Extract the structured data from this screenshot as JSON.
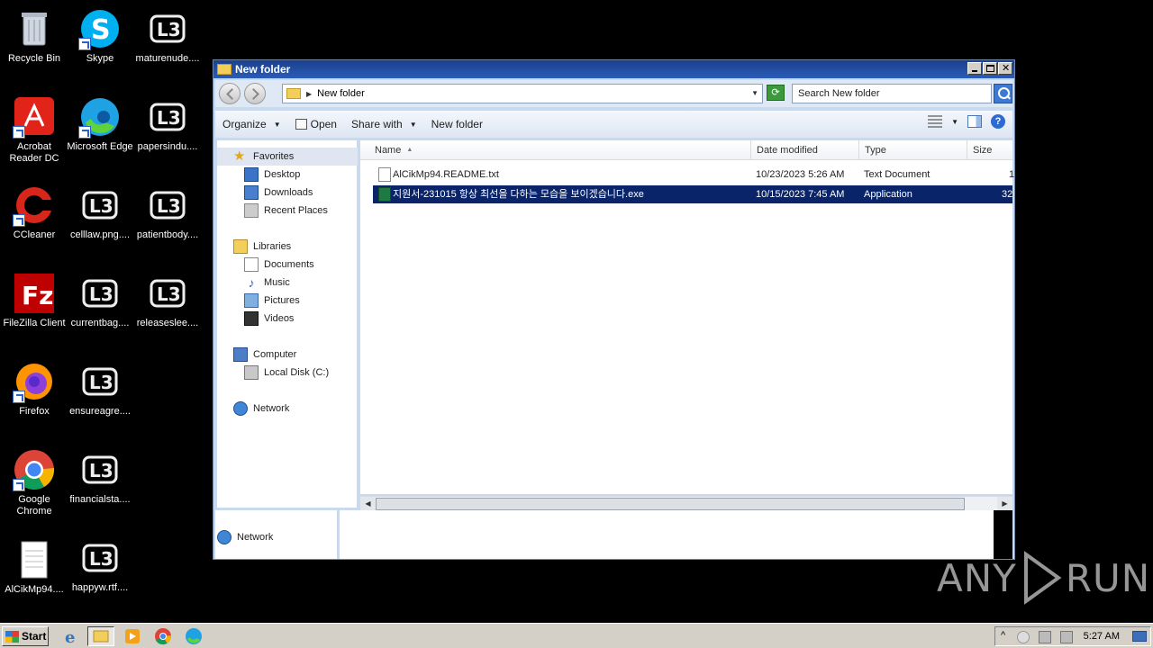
{
  "desktop": {
    "icons": [
      {
        "label": "Recycle Bin",
        "icon": "recycle-bin-icon"
      },
      {
        "label": "Skype",
        "icon": "skype-icon"
      },
      {
        "label": "maturenude....",
        "icon": "generic-doc-icon"
      },
      {
        "label": "Acrobat Reader DC",
        "icon": "acrobat-icon"
      },
      {
        "label": "Microsoft Edge",
        "icon": "edge-icon"
      },
      {
        "label": "papersindu....",
        "icon": "generic-doc-icon"
      },
      {
        "label": "CCleaner",
        "icon": "ccleaner-icon"
      },
      {
        "label": "celllaw.png....",
        "icon": "generic-doc-icon"
      },
      {
        "label": "patientbody....",
        "icon": "generic-doc-icon"
      },
      {
        "label": "FileZilla Client",
        "icon": "filezilla-icon"
      },
      {
        "label": "currentbag....",
        "icon": "generic-doc-icon"
      },
      {
        "label": "releaseslee....",
        "icon": "generic-doc-icon"
      },
      {
        "label": "Firefox",
        "icon": "firefox-icon"
      },
      {
        "label": "ensureagre....",
        "icon": "generic-doc-icon"
      },
      {
        "label": "Google Chrome",
        "icon": "chrome-icon"
      },
      {
        "label": "financialsta....",
        "icon": "generic-doc-icon"
      },
      {
        "label": "AlCikMp94....",
        "icon": "text-file-icon"
      },
      {
        "label": "happyw.rtf....",
        "icon": "generic-doc-icon"
      }
    ]
  },
  "window": {
    "title": "New folder",
    "address": "New folder",
    "search_placeholder": "Search New folder",
    "toolbar": {
      "organize": "Organize",
      "open": "Open",
      "share_with": "Share with",
      "new_folder": "New folder"
    },
    "nav": {
      "favorites": "Favorites",
      "desktop": "Desktop",
      "downloads": "Downloads",
      "recent_places": "Recent Places",
      "libraries": "Libraries",
      "documents": "Documents",
      "music": "Music",
      "pictures": "Pictures",
      "videos": "Videos",
      "computer": "Computer",
      "local_disk": "Local Disk (C:)",
      "network": "Network",
      "network_bottom": "Network"
    },
    "columns": {
      "name": "Name",
      "date_modified": "Date modified",
      "type": "Type",
      "size": "Size"
    },
    "files": [
      {
        "name": "AlCikMp94.README.txt",
        "date": "10/23/2023 5:26 AM",
        "type": "Text Document",
        "size": "1",
        "icon": "text-file-icon",
        "selected": false
      },
      {
        "name": "지원서-231015 항상 최선을 다하는 모습을 보이겠습니다.exe",
        "date": "10/15/2023 7:45 AM",
        "type": "Application",
        "size": "32",
        "icon": "exe-file-icon",
        "selected": true
      }
    ]
  },
  "taskbar": {
    "start_label": "Start",
    "clock": "5:27 AM"
  },
  "watermark": {
    "text_left": "ANY",
    "text_right": "RUN"
  },
  "colors": {
    "selection": "#0a246a",
    "titlebar": "#1c3f8c",
    "desktop": "#000000"
  }
}
